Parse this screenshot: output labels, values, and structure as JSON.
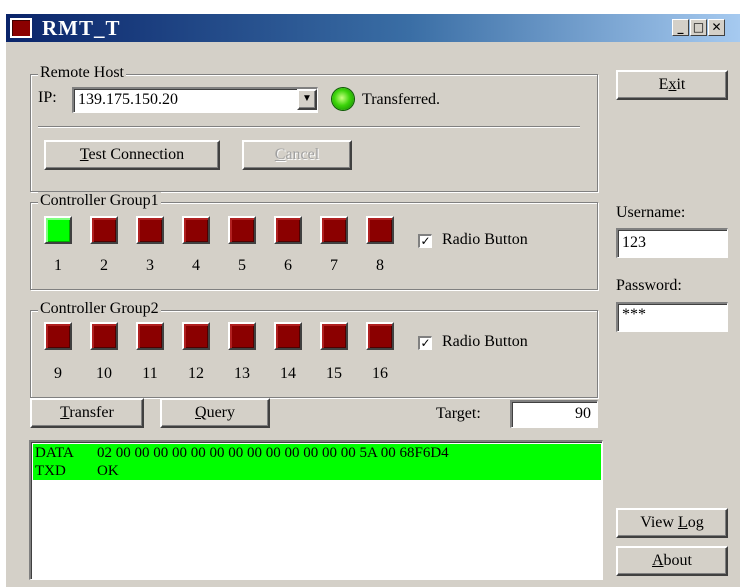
{
  "window": {
    "title": "RMT_T",
    "controls": {
      "minimize": "_",
      "maximize": "□",
      "close": "✕"
    }
  },
  "remote_host": {
    "label": "Remote Host",
    "ip_label": "IP:",
    "ip_value": "139.175.150.20",
    "status_text": "Transferred.",
    "test_connection_label": "Test Connection",
    "cancel_label": "Cancel"
  },
  "group1": {
    "label": "Controller Group1",
    "checkbox_label": "Radio Button",
    "checked": true,
    "controllers": [
      {
        "num": "1",
        "state": "on"
      },
      {
        "num": "2",
        "state": "off"
      },
      {
        "num": "3",
        "state": "off"
      },
      {
        "num": "4",
        "state": "off"
      },
      {
        "num": "5",
        "state": "off"
      },
      {
        "num": "6",
        "state": "off"
      },
      {
        "num": "7",
        "state": "off"
      },
      {
        "num": "8",
        "state": "off"
      }
    ]
  },
  "group2": {
    "label": "Controller Group2",
    "checkbox_label": "Radio Button",
    "checked": true,
    "controllers": [
      {
        "num": "9",
        "state": "off"
      },
      {
        "num": "10",
        "state": "off"
      },
      {
        "num": "11",
        "state": "off"
      },
      {
        "num": "12",
        "state": "off"
      },
      {
        "num": "13",
        "state": "off"
      },
      {
        "num": "14",
        "state": "off"
      },
      {
        "num": "15",
        "state": "off"
      },
      {
        "num": "16",
        "state": "off"
      }
    ]
  },
  "actions": {
    "transfer_label": "Transfer",
    "query_label": "Query",
    "target_label": "Target:",
    "target_value": "90"
  },
  "log": [
    {
      "key": "DATA",
      "value": "02 00 00 00 00 00 00 00 00 00 00 00 00 00 5A 00 68F6D4"
    },
    {
      "key": "TXD",
      "value": "OK"
    }
  ],
  "side": {
    "exit_label": "Exit",
    "username_label": "Username:",
    "username_value": "123",
    "password_label": "Password:",
    "password_value": "***",
    "view_log_label": "View Log",
    "about_label": "About"
  },
  "colors": {
    "controller_on": "#00ff00",
    "controller_off": "#8b0000",
    "log_highlight": "#00ff00",
    "titlebar": "#0a246a"
  }
}
